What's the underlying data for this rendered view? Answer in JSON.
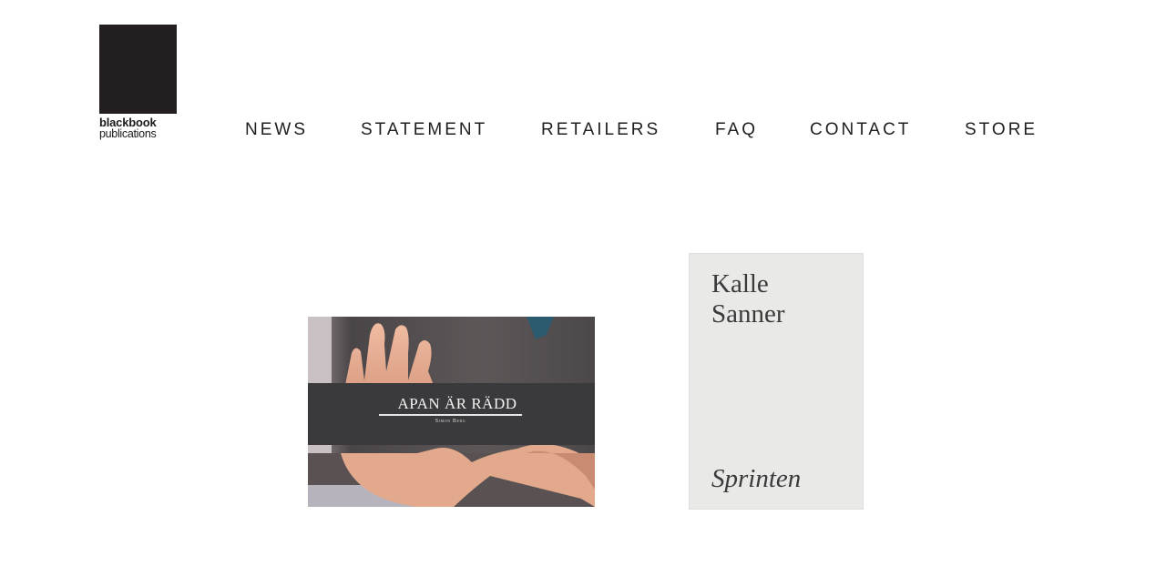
{
  "brand": {
    "line1": "blackbook",
    "line2": "publications"
  },
  "nav": {
    "items": [
      "NEWS",
      "STATEMENT",
      "RETAILERS",
      "FAQ",
      "CONTACT",
      "STORE"
    ]
  },
  "books": [
    {
      "cover_title": "APAN ÄR RÄDD",
      "cover_author": "Simon Berg",
      "band_color": "#3a3a3c"
    },
    {
      "cover_author": "Kalle Sanner",
      "cover_author_lines": [
        "Kalle",
        "Sanner"
      ],
      "cover_title": "Sprinten",
      "cover_color": "#e9e9e8"
    }
  ]
}
